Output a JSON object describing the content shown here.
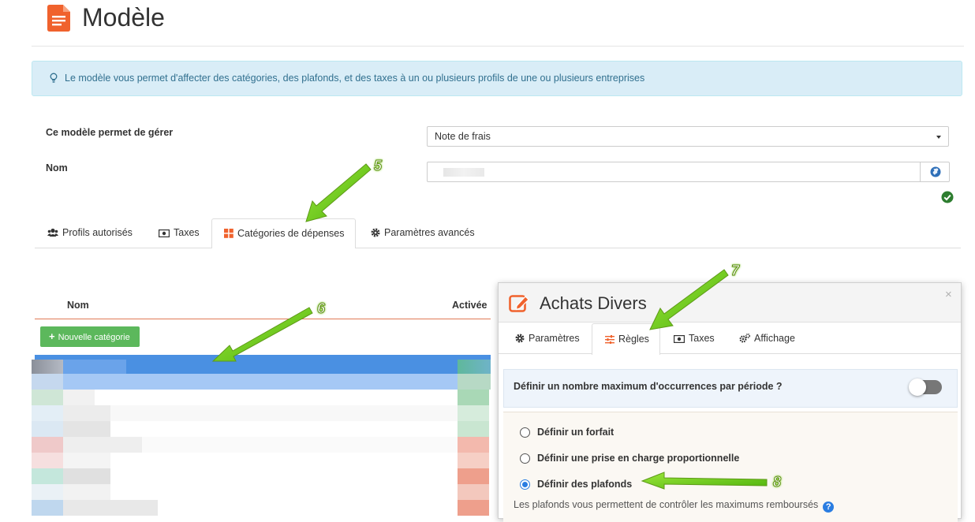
{
  "header": {
    "title": "Modèle"
  },
  "info_banner": {
    "text": "Le modèle vous permet d'affecter des catégories, des plafonds, et des taxes à un ou plusieurs profils de une ou plusieurs entreprises"
  },
  "form": {
    "manage_label": "Ce modèle permet de gérer",
    "manage_value": "Note de frais",
    "name_label": "Nom"
  },
  "tabs": [
    {
      "label": "Profils autorisés",
      "icon": "users-icon"
    },
    {
      "label": "Taxes",
      "icon": "money-icon"
    },
    {
      "label": "Catégories de dépenses",
      "icon": "grid-icon",
      "active": true
    },
    {
      "label": "Paramètres avancés",
      "icon": "gear-icon"
    }
  ],
  "category_list": {
    "col_name": "Nom",
    "col_active": "Activée",
    "new_button": "Nouvelle catégorie"
  },
  "modal": {
    "title": "Achats Divers",
    "close": "×",
    "tabs": [
      {
        "label": "Paramètres",
        "icon": "gear-icon"
      },
      {
        "label": "Règles",
        "icon": "sliders-icon",
        "active": true
      },
      {
        "label": "Taxes",
        "icon": "money-icon"
      },
      {
        "label": "Affichage",
        "icon": "gears-icon"
      }
    ],
    "occurrence_label": "Définir un nombre maximum d'occurrences par période ?",
    "occurrence_enabled": false,
    "options": [
      {
        "label": "Définir un forfait",
        "checked": false
      },
      {
        "label": "Définir une prise en charge proportionnelle",
        "checked": false
      },
      {
        "label": "Définir des plafonds",
        "checked": true
      }
    ],
    "plafond_help": "Les plafonds vous permettent de contrôler les maximums remboursés",
    "help_icon": "?"
  },
  "annotations": [
    "5",
    "6",
    "7",
    "8"
  ],
  "colors": {
    "accent_orange": "#f0622d",
    "info_bg": "#d9edf7",
    "success_green": "#5cb85c",
    "selected_blue": "#4a90e2",
    "annotation_green": "#6fcc1a"
  }
}
